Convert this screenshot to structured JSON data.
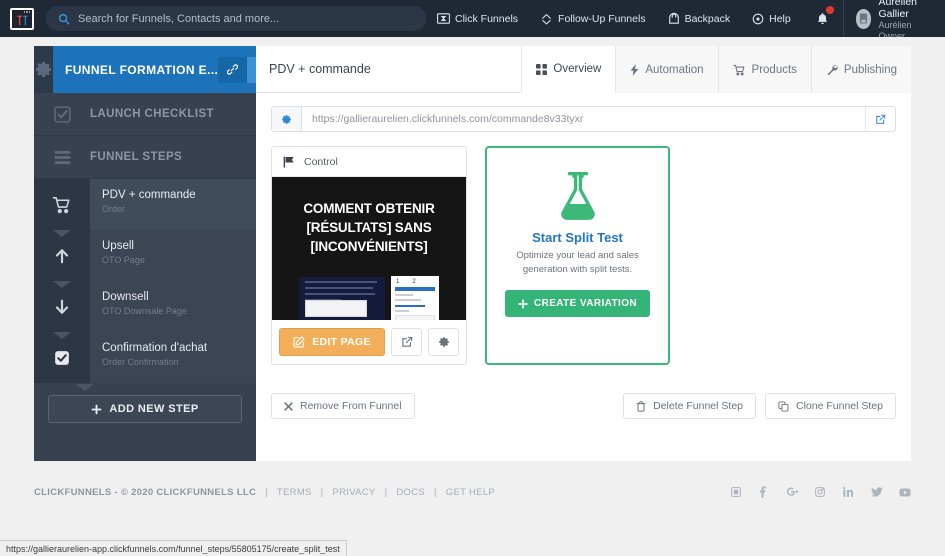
{
  "topnav": {
    "logo_icon": "clickfunnels-logo-icon",
    "search": {
      "icon": "search-icon",
      "placeholder": "Search for Funnels, Contacts and more...",
      "value": ""
    },
    "items": [
      {
        "label": "Click Funnels",
        "icon": "clickfunnels-icon"
      },
      {
        "label": "Follow-Up Funnels",
        "icon": "follow-up-funnels-icon"
      },
      {
        "label": "Backpack",
        "icon": "backpack-icon"
      },
      {
        "label": "Help",
        "icon": "help-icon"
      }
    ],
    "bell_icon": "notification-bell-icon",
    "user": {
      "name": "Aurélien Gallier",
      "first_name": "Aurélien",
      "role": "Owner",
      "avatar_icon": "avatar-icon"
    }
  },
  "sidebar": {
    "funnel_header": {
      "gear_icon": "gear-icon",
      "title": "FUNNEL FORMATION E...",
      "icons": [
        "link-icon",
        "copy-icon",
        "external-link-icon",
        "help-circle-icon"
      ]
    },
    "rows": [
      {
        "label": "LAUNCH CHECKLIST",
        "icon": "checklist-icon"
      },
      {
        "label": "FUNNEL STEPS",
        "icon": "hamburger-icon"
      }
    ],
    "steps": [
      {
        "name": "PDV + commande",
        "sub": "Order",
        "icon": "cart-icon",
        "active": true
      },
      {
        "name": "Upsell",
        "sub": "OTO Page",
        "icon": "arrow-up-icon",
        "active": false
      },
      {
        "name": "Downsell",
        "sub": "OTO Downsale Page",
        "icon": "arrow-down-icon",
        "active": false
      },
      {
        "name": "Confirmation d'achat",
        "sub": "Order Confirmation",
        "icon": "checkbox-icon",
        "active": false
      }
    ],
    "add_step_label": "ADD NEW STEP",
    "add_step_icon": "plus-icon"
  },
  "content": {
    "step_title": "PDV + commande",
    "tabs": [
      {
        "label": "Overview",
        "icon": "grid-icon",
        "active": true
      },
      {
        "label": "Automation",
        "icon": "bolt-icon",
        "active": false
      },
      {
        "label": "Products",
        "icon": "cart-icon",
        "active": false
      },
      {
        "label": "Publishing",
        "icon": "wrench-icon",
        "active": false
      }
    ],
    "url_bar": {
      "gear_icon": "gear-icon",
      "url": "https://gallieraurelien.clickfunnels.com/commande8v33tyxr",
      "external_icon": "external-link-icon"
    },
    "control_card": {
      "header_label": "Control",
      "header_icon": "flag-icon",
      "preview_headline": "COMMENT OBTENIR [RÉSULTATS] SANS [INCONVÉNIENTS]",
      "edit_label": "EDIT PAGE",
      "edit_icon": "pencil-square-icon",
      "external_icon": "external-link-icon",
      "settings_icon": "gear-icon"
    },
    "split_card": {
      "flask_icon": "flask-icon",
      "title": "Start Split Test",
      "description": "Optimize your lead and sales generation with split tests.",
      "button_label": "CREATE VARIATION",
      "button_icon": "plus-icon"
    },
    "actions": {
      "remove": {
        "label": "Remove From Funnel",
        "icon": "x-icon"
      },
      "delete": {
        "label": "Delete Funnel Step",
        "icon": "trash-icon"
      },
      "clone": {
        "label": "Clone Funnel Step",
        "icon": "copy-icon"
      }
    }
  },
  "footer": {
    "copyright": "CLICKFUNNELS - © 2020 CLICKFUNNELS LLC",
    "links": [
      "TERMS",
      "PRIVACY",
      "DOCS",
      "GET HELP"
    ],
    "separator": "|",
    "social": [
      "grid-icon",
      "facebook-icon",
      "google-plus-icon",
      "instagram-icon",
      "linkedin-icon",
      "twitter-icon",
      "youtube-icon"
    ]
  },
  "status_bar": {
    "url": "https://gallieraurelien-app.clickfunnels.com/funnel_steps/55805175/create_split_test"
  },
  "colors": {
    "topnav_bg": "#1f2936",
    "funnel_header_blue": "#1c73ba",
    "sidebar_bg": "#37414f",
    "accent_orange": "#f3ae5a",
    "accent_green": "#3cb878",
    "link_blue": "#2277c2"
  }
}
